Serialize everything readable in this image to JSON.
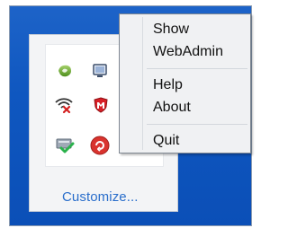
{
  "tray": {
    "customize_label": "Customize...",
    "icons": [
      "nvidia-icon",
      "monitor-icon",
      "network-disconnected-icon",
      "mcafee-shield-icon",
      "safely-remove-hardware-icon",
      "refresh-update-icon"
    ]
  },
  "context_menu": {
    "items": [
      {
        "label": "Show"
      },
      {
        "label": "WebAdmin"
      },
      {
        "label": "Help"
      },
      {
        "label": "About"
      },
      {
        "label": "Quit"
      }
    ]
  },
  "colors": {
    "desktop": "#1d63c8",
    "link": "#2a6ecb",
    "menu_bg": "#f0f1f3"
  }
}
